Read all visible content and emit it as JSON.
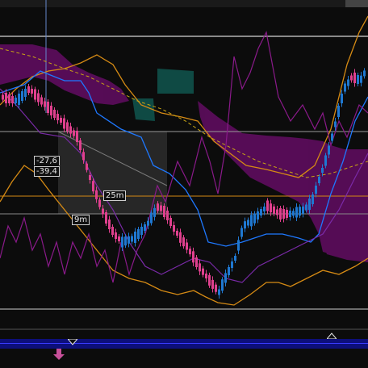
{
  "measure": {
    "upper_value": "-27,6",
    "lower_value": "-39,4"
  },
  "time_tags": {
    "tag_a": "25m",
    "tag_b": "9m"
  },
  "colors": {
    "background": "#0c0c0c",
    "cloud": "#6e0f6e",
    "cloud_teal": "#0f4a44",
    "bull_candle": "#1f78d1",
    "bear_candle": "#e0408e",
    "orange_band": "#d58a14",
    "blue_line": "#1e78ff",
    "purple_line": "#8a1a8a",
    "timeline_bar": "#0d0f7a",
    "nav_arrow": "#c8509a"
  },
  "icons": {
    "timeline_up": "triangle-up-icon",
    "timeline_down": "triangle-down-icon",
    "navigate": "arrow-down-icon"
  }
}
